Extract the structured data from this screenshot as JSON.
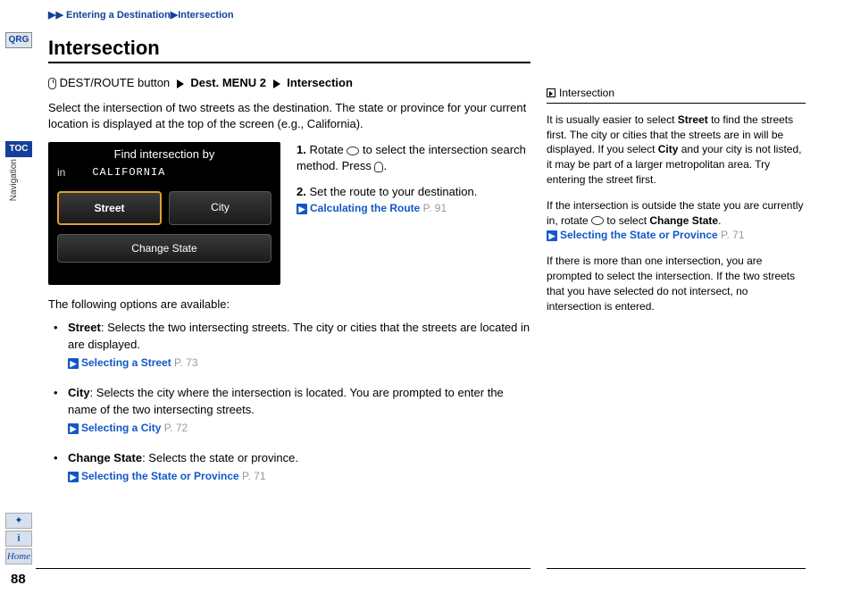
{
  "rail": {
    "qrg": "QRG",
    "toc": "TOC",
    "nav": "Navigation",
    "tool_voice": "✦",
    "tool_info": "i",
    "tool_home": "Home",
    "page": "88"
  },
  "breadcrumb": {
    "a": "▶",
    "b": "▶",
    "seg1": "Entering a Destination",
    "c": "▶",
    "seg2": "Intersection"
  },
  "title": "Intersection",
  "menu_path": {
    "prefix": "DEST/ROUTE button",
    "seg1": "Dest. MENU 2",
    "seg2": "Intersection"
  },
  "intro": "Select the intersection of two streets as the destination. The state or province for your current location is displayed at the top of the screen (e.g., California).",
  "fake_screen": {
    "title": "Find intersection by",
    "in": "in",
    "state": "CALIFORNIA",
    "btn_street": "Street",
    "btn_city": "City",
    "btn_change": "Change State"
  },
  "steps": {
    "s1a": "1.",
    "s1b": "Rotate ",
    "s1c": " to select the intersection search method. Press ",
    "s1d": ".",
    "s2a": "2.",
    "s2b": "Set the route to your destination.",
    "link1": "Calculating the Route",
    "link1p": " P. 91"
  },
  "options_intro": "The following options are available:",
  "opt_street": {
    "name": "Street",
    "desc": ": Selects the two intersecting streets. The city or cities that the streets are located in are displayed.",
    "link": "Selecting a Street",
    "linkp": " P. 73"
  },
  "opt_city": {
    "name": "City",
    "desc": ": Selects the city where the intersection is located. You are prompted to enter the name of the two intersecting streets.",
    "link": "Selecting a City",
    "linkp": " P. 72"
  },
  "opt_change": {
    "name": "Change State",
    "desc": ": Selects the state or province.",
    "link": "Selecting the State or Province",
    "linkp": " P. 71"
  },
  "sidebar": {
    "head": "Intersection",
    "p1a": "It is usually easier to select ",
    "p1b": "Street",
    "p1c": " to find the streets first. The city or cities that the streets are in will be displayed. If you select ",
    "p1d": "City",
    "p1e": " and your city is not listed, it may be part of a larger metropolitan area. Try entering the street first.",
    "p2a": "If the intersection is outside the state you are currently in, rotate ",
    "p2b": " to select ",
    "p2c": "Change State",
    "p2d": ".",
    "p2link": "Selecting the State or Province",
    "p2linkp": " P. 71",
    "p3": "If there is more than one intersection, you are prompted to select the intersection. If the two streets that you have selected do not intersect, no intersection is entered."
  }
}
